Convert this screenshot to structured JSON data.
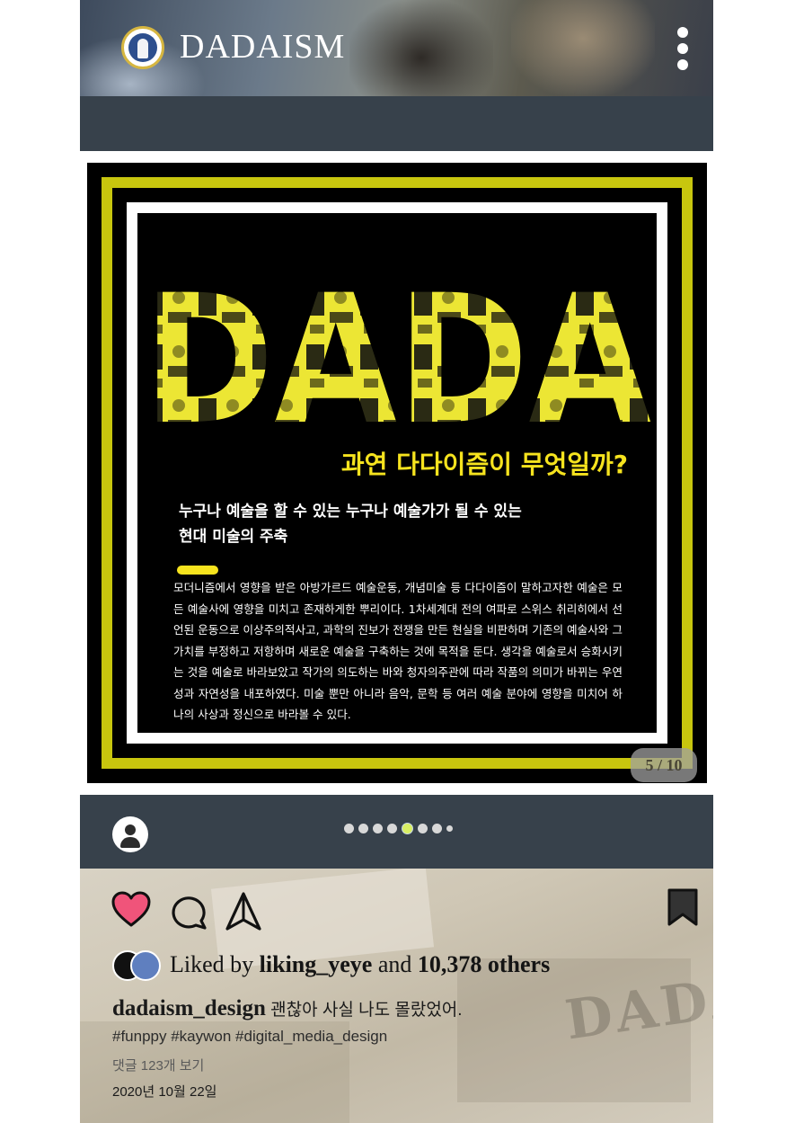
{
  "header": {
    "brand": "DADAISM",
    "logo_icon": "dadaism-logo-icon",
    "menu_icon": "kebab-menu-icon"
  },
  "post": {
    "image_title": "DADA",
    "question": "과연 다다이즘이 무엇일까?",
    "subtitle_line1": "누구나 예술을 할 수 있는 누구나 예술가가 될 수 있는",
    "subtitle_line2": "현대 미술의 주축",
    "body": " 모더니즘에서 영향을 받은 아방가르드 예술운동, 개념미술 등 다다이즘이 말하고자한 예술은 모든 예술사에 영향을 미치고 존재하게한 뿌리이다. 1차세계대 전의 여파로 스위스 취리히에서 선언된 운동으로 이상주의적사고, 과학의 진보가 전쟁을 만든 현실을 비판하며 기존의 예술사와 그 가치를 부정하고 저항하며 새로운 예술을 구축하는 것에 목적을 둔다. 생각을 예술로서 승화시키는 것을 예술로 바라보았고 작가의 의도하는 바와 청자의주관에 따라 작품의 의미가 바뀌는 우연성과 자연성을 내포하였다. 미술 뿐만 아니라 음악, 문학 등 여러 예술 분야에 영향을 미치어 하나의 사상과 정신으로 바라볼 수 있다.",
    "counter": "5 / 10",
    "accent_color": "#f6e31e",
    "frame_color": "#c8c60e"
  },
  "carousel": {
    "current": 5,
    "total": 8
  },
  "actions": {
    "like_icon": "heart-icon",
    "comment_icon": "comment-icon",
    "share_icon": "send-icon",
    "save_icon": "bookmark-icon"
  },
  "likes": {
    "prefix": "Liked by",
    "user": "liking_yeye",
    "and": "and",
    "others": "10,378 others"
  },
  "caption": {
    "user": "dadaism_design",
    "text": "괜찮아 사실 나도 몰랐었어."
  },
  "tags": "#funppy #kaywon #digital_media_design",
  "comments_link": "댓글 123개 보기",
  "date": "2020년 10월 22일"
}
